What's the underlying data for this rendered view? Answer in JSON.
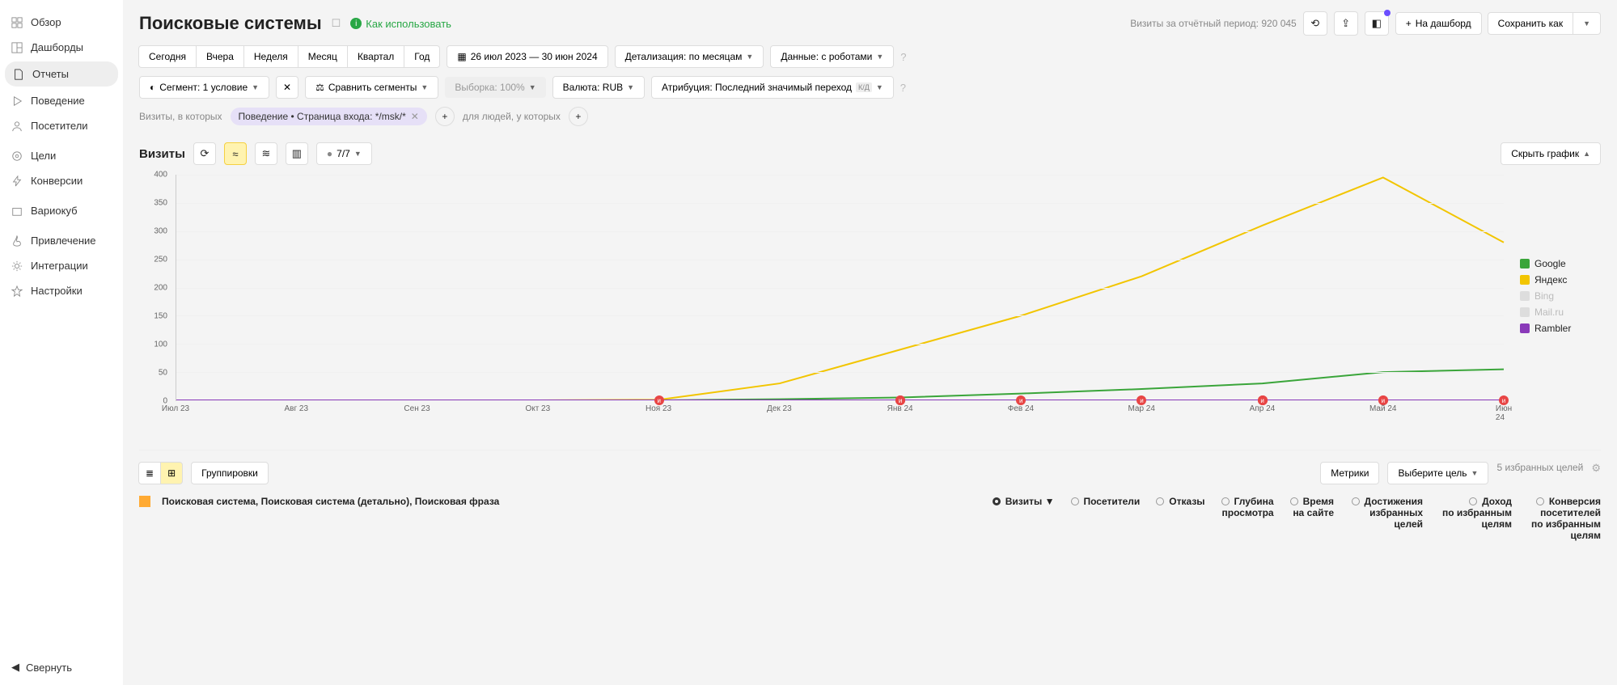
{
  "sidebar": {
    "items": [
      {
        "label": "Обзор",
        "icon": "grid"
      },
      {
        "label": "Дашборды",
        "icon": "dashboard"
      },
      {
        "label": "Отчеты",
        "icon": "file",
        "active": true
      },
      {
        "label": "Поведение",
        "icon": "play"
      },
      {
        "label": "Посетители",
        "icon": "user"
      }
    ],
    "group2": [
      {
        "label": "Цели",
        "icon": "target"
      },
      {
        "label": "Конверсии",
        "icon": "lightning"
      }
    ],
    "group3": [
      {
        "label": "Вариокуб",
        "icon": "box"
      }
    ],
    "group4": [
      {
        "label": "Привлечение",
        "icon": "flame"
      },
      {
        "label": "Интеграции",
        "icon": "gear"
      },
      {
        "label": "Настройки",
        "icon": "star"
      }
    ],
    "collapse": "Свернуть"
  },
  "header": {
    "title": "Поисковые системы",
    "how_to": "Как использовать",
    "period_text": "Визиты за отчётный период: 920 045",
    "to_dashboard": "На дашборд",
    "save_as": "Сохранить как"
  },
  "toolbar": {
    "periods": [
      "Сегодня",
      "Вчера",
      "Неделя",
      "Месяц",
      "Квартал",
      "Год"
    ],
    "date_range": "26 июл 2023 — 30 июн 2024",
    "detail": "Детализация: по месяцам",
    "data": "Данные: с роботами",
    "segment": "Сегмент: 1 условие",
    "compare": "Сравнить сегменты",
    "sample": "Выборка: 100%",
    "currency": "Валюта: RUB",
    "attribution": "Атрибуция: Последний значимый переход",
    "kd": "К/Д"
  },
  "segments": {
    "visits_label": "Визиты, в которых",
    "chip": "Поведение • Страница входа: */msk/*",
    "people_label": "для людей, у которых"
  },
  "chart": {
    "title": "Визиты",
    "series_count": "7/7",
    "hide": "Скрыть график"
  },
  "chart_data": {
    "type": "line",
    "categories": [
      "Июл 23",
      "Авг 23",
      "Сен 23",
      "Окт 23",
      "Ноя 23",
      "Дек 23",
      "Янв 24",
      "Фев 24",
      "Мар 24",
      "Апр 24",
      "Май 24",
      "Июн 24"
    ],
    "ylim": [
      0,
      400
    ],
    "yticks": [
      0,
      50,
      100,
      150,
      200,
      250,
      300,
      350,
      400
    ],
    "series": [
      {
        "name": "Google",
        "color": "#3aa53a",
        "values": [
          0,
          0,
          0,
          0,
          0,
          2,
          5,
          12,
          20,
          30,
          50,
          55
        ]
      },
      {
        "name": "Яндекс",
        "color": "#f2c500",
        "values": [
          0,
          0,
          0,
          0,
          1,
          30,
          90,
          150,
          220,
          310,
          395,
          280
        ]
      },
      {
        "name": "Bing",
        "color": "#cccccc",
        "values": [
          0,
          0,
          0,
          0,
          0,
          0,
          0,
          0,
          0,
          0,
          0,
          0
        ],
        "disabled": true
      },
      {
        "name": "Mail.ru",
        "color": "#cccccc",
        "values": [
          0,
          0,
          0,
          0,
          0,
          0,
          0,
          0,
          0,
          0,
          0,
          0
        ],
        "disabled": true
      },
      {
        "name": "Rambler",
        "color": "#8a3ab9",
        "values": [
          0,
          0,
          0,
          0,
          0,
          0,
          0,
          0,
          0,
          0,
          0,
          0
        ]
      }
    ],
    "markers_x": [
      4,
      6,
      6,
      6,
      7,
      8,
      9,
      9,
      9,
      10,
      10,
      11
    ]
  },
  "table": {
    "metrics_btn": "Метрики",
    "goal_select": "Выберите цель",
    "fav_goals": "5 избранных целей",
    "grouping": "Группировки",
    "dimension": "Поисковая система, Поисковая система (детально), Поисковая фраза",
    "columns": [
      "Визиты",
      "Посетители",
      "Отказы",
      "Глубина просмотра",
      "Время на сайте",
      "Достижения избранных целей",
      "Доход по избранным целям",
      "Конверсия посетителей по избранным целям"
    ]
  }
}
